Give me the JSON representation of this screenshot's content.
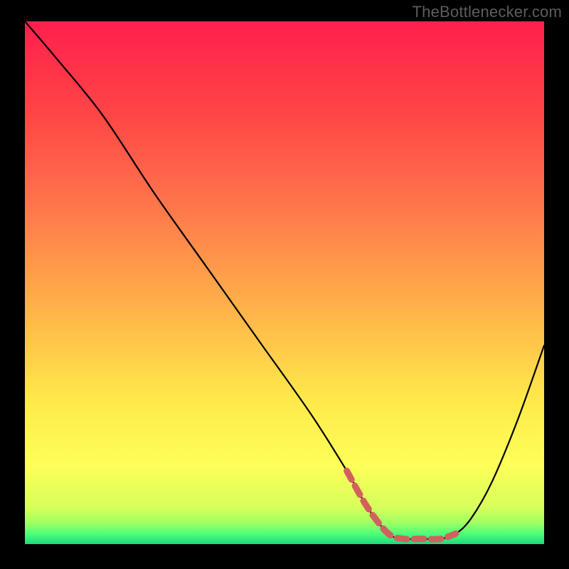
{
  "watermark": "TheBottlenecker.com",
  "chart_data": {
    "type": "line",
    "title": "",
    "xlabel": "",
    "ylabel": "",
    "xlim": [
      0,
      100
    ],
    "ylim": [
      0,
      100
    ],
    "series": [
      {
        "name": "bottleneck-curve",
        "x": [
          0,
          6,
          15,
          25,
          35,
          45,
          55,
          62,
          66,
          70,
          73,
          76,
          80,
          83,
          86,
          90,
          95,
          100
        ],
        "values": [
          100,
          93,
          82,
          67,
          53,
          39,
          25,
          14,
          7,
          2,
          1,
          1,
          1,
          2,
          5,
          12,
          24,
          38
        ]
      }
    ],
    "highlight": {
      "x_start": 62,
      "x_end": 83,
      "color": "#d2605f"
    },
    "background_gradient": {
      "stops": [
        {
          "offset": 0,
          "color": "#ff1f4c"
        },
        {
          "offset": 18,
          "color": "#ff4646"
        },
        {
          "offset": 35,
          "color": "#ff754b"
        },
        {
          "offset": 55,
          "color": "#ffb24a"
        },
        {
          "offset": 72,
          "color": "#ffe84a"
        },
        {
          "offset": 85,
          "color": "#fdff59"
        },
        {
          "offset": 93,
          "color": "#d6ff5a"
        },
        {
          "offset": 96,
          "color": "#9dff63"
        },
        {
          "offset": 98,
          "color": "#4eff79"
        },
        {
          "offset": 100,
          "color": "#1dd97c"
        }
      ]
    }
  }
}
